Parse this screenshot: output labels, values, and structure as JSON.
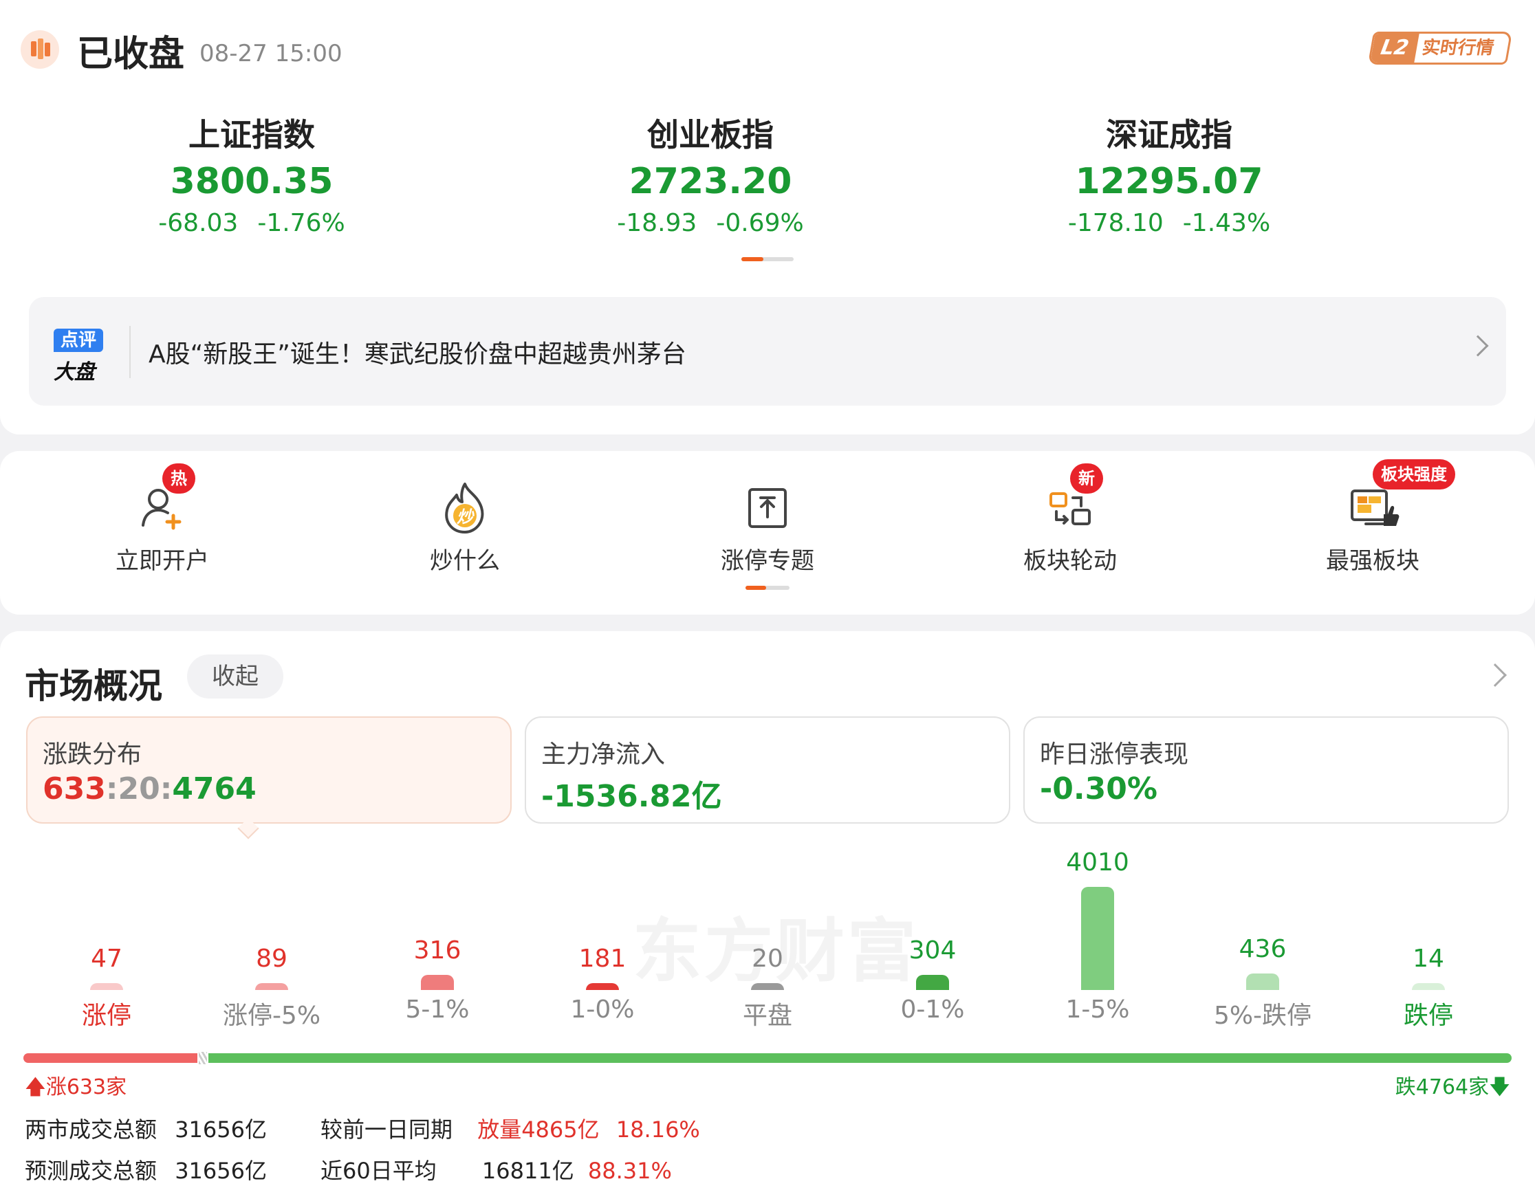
{
  "status": {
    "title": "已收盘",
    "time": "08-27 15:00",
    "badge_tag": "L2",
    "badge_text": "实时行情"
  },
  "indices": [
    {
      "name": "上证指数",
      "price": "3800.35",
      "change": "-68.03",
      "percent": "-1.76%"
    },
    {
      "name": "创业板指",
      "price": "2723.20",
      "change": "-18.93",
      "percent": "-0.69%"
    },
    {
      "name": "深证成指",
      "price": "12295.07",
      "change": "-178.10",
      "percent": "-1.43%"
    }
  ],
  "news": {
    "logo_top": "点评",
    "logo_bottom": "大盘",
    "text": "A股“新股王”诞生！寒武纪股价盘中超越贵州茅台"
  },
  "quick_actions": [
    {
      "label": "立即开户",
      "badge": "热",
      "icon": "user-add-icon"
    },
    {
      "label": "炒什么",
      "badge": "",
      "icon": "flame-icon",
      "icon_text": "炒"
    },
    {
      "label": "涨停专题",
      "badge": "",
      "icon": "limit-up-topic-icon"
    },
    {
      "label": "板块轮动",
      "badge": "新",
      "icon": "rotation-icon"
    },
    {
      "label": "最强板块",
      "badge": "板块强度",
      "icon": "strongest-sector-icon"
    }
  ],
  "market": {
    "title": "市场概况",
    "collapse_label": "收起",
    "cards": [
      {
        "label": "涨跌分布",
        "up": "633",
        "flat": "20",
        "down": "4764"
      },
      {
        "label": "主力净流入",
        "value": "-1536.82亿"
      },
      {
        "label": "昨日涨停表现",
        "value": "-0.30%"
      }
    ],
    "watermark": "东方财富",
    "up_label": "涨633家",
    "down_label": "跌4764家",
    "up_ratio": 0.1168,
    "volume": {
      "row1_label": "两市成交总额",
      "row1_value": "31656亿",
      "row1_cmp_label": "较前一日同期",
      "row1_cmp_value": "放量4865亿",
      "row1_cmp_pct": "18.16%",
      "row2_label": "预测成交总额",
      "row2_value": "31656亿",
      "row2_cmp_label": "近60日平均",
      "row2_cmp_value": "16811亿",
      "row2_cmp_pct": "88.31%"
    }
  },
  "chart_data": {
    "type": "bar",
    "categories": [
      "涨停",
      "涨停-5%",
      "5-1%",
      "1-0%",
      "平盘",
      "0-1%",
      "1-5%",
      "5%-跌停",
      "跌停"
    ],
    "values": [
      47,
      89,
      316,
      181,
      20,
      304,
      4010,
      436,
      14
    ],
    "colors": [
      "#f9c9c9",
      "#f4a0a0",
      "#ef7c7c",
      "#e53935",
      "#9a9a9a",
      "#43a843",
      "#7fcd7f",
      "#b2e0b2",
      "#d9f0d9"
    ],
    "value_colors": [
      "#e0322b",
      "#e0322b",
      "#e0322b",
      "#e0322b",
      "#888888",
      "#1a9a33",
      "#1a9a33",
      "#1a9a33",
      "#1a9a33"
    ],
    "label_colors": [
      "#e0322b",
      "#888888",
      "#888888",
      "#888888",
      "#888888",
      "#888888",
      "#888888",
      "#888888",
      "#1a9a33"
    ]
  }
}
